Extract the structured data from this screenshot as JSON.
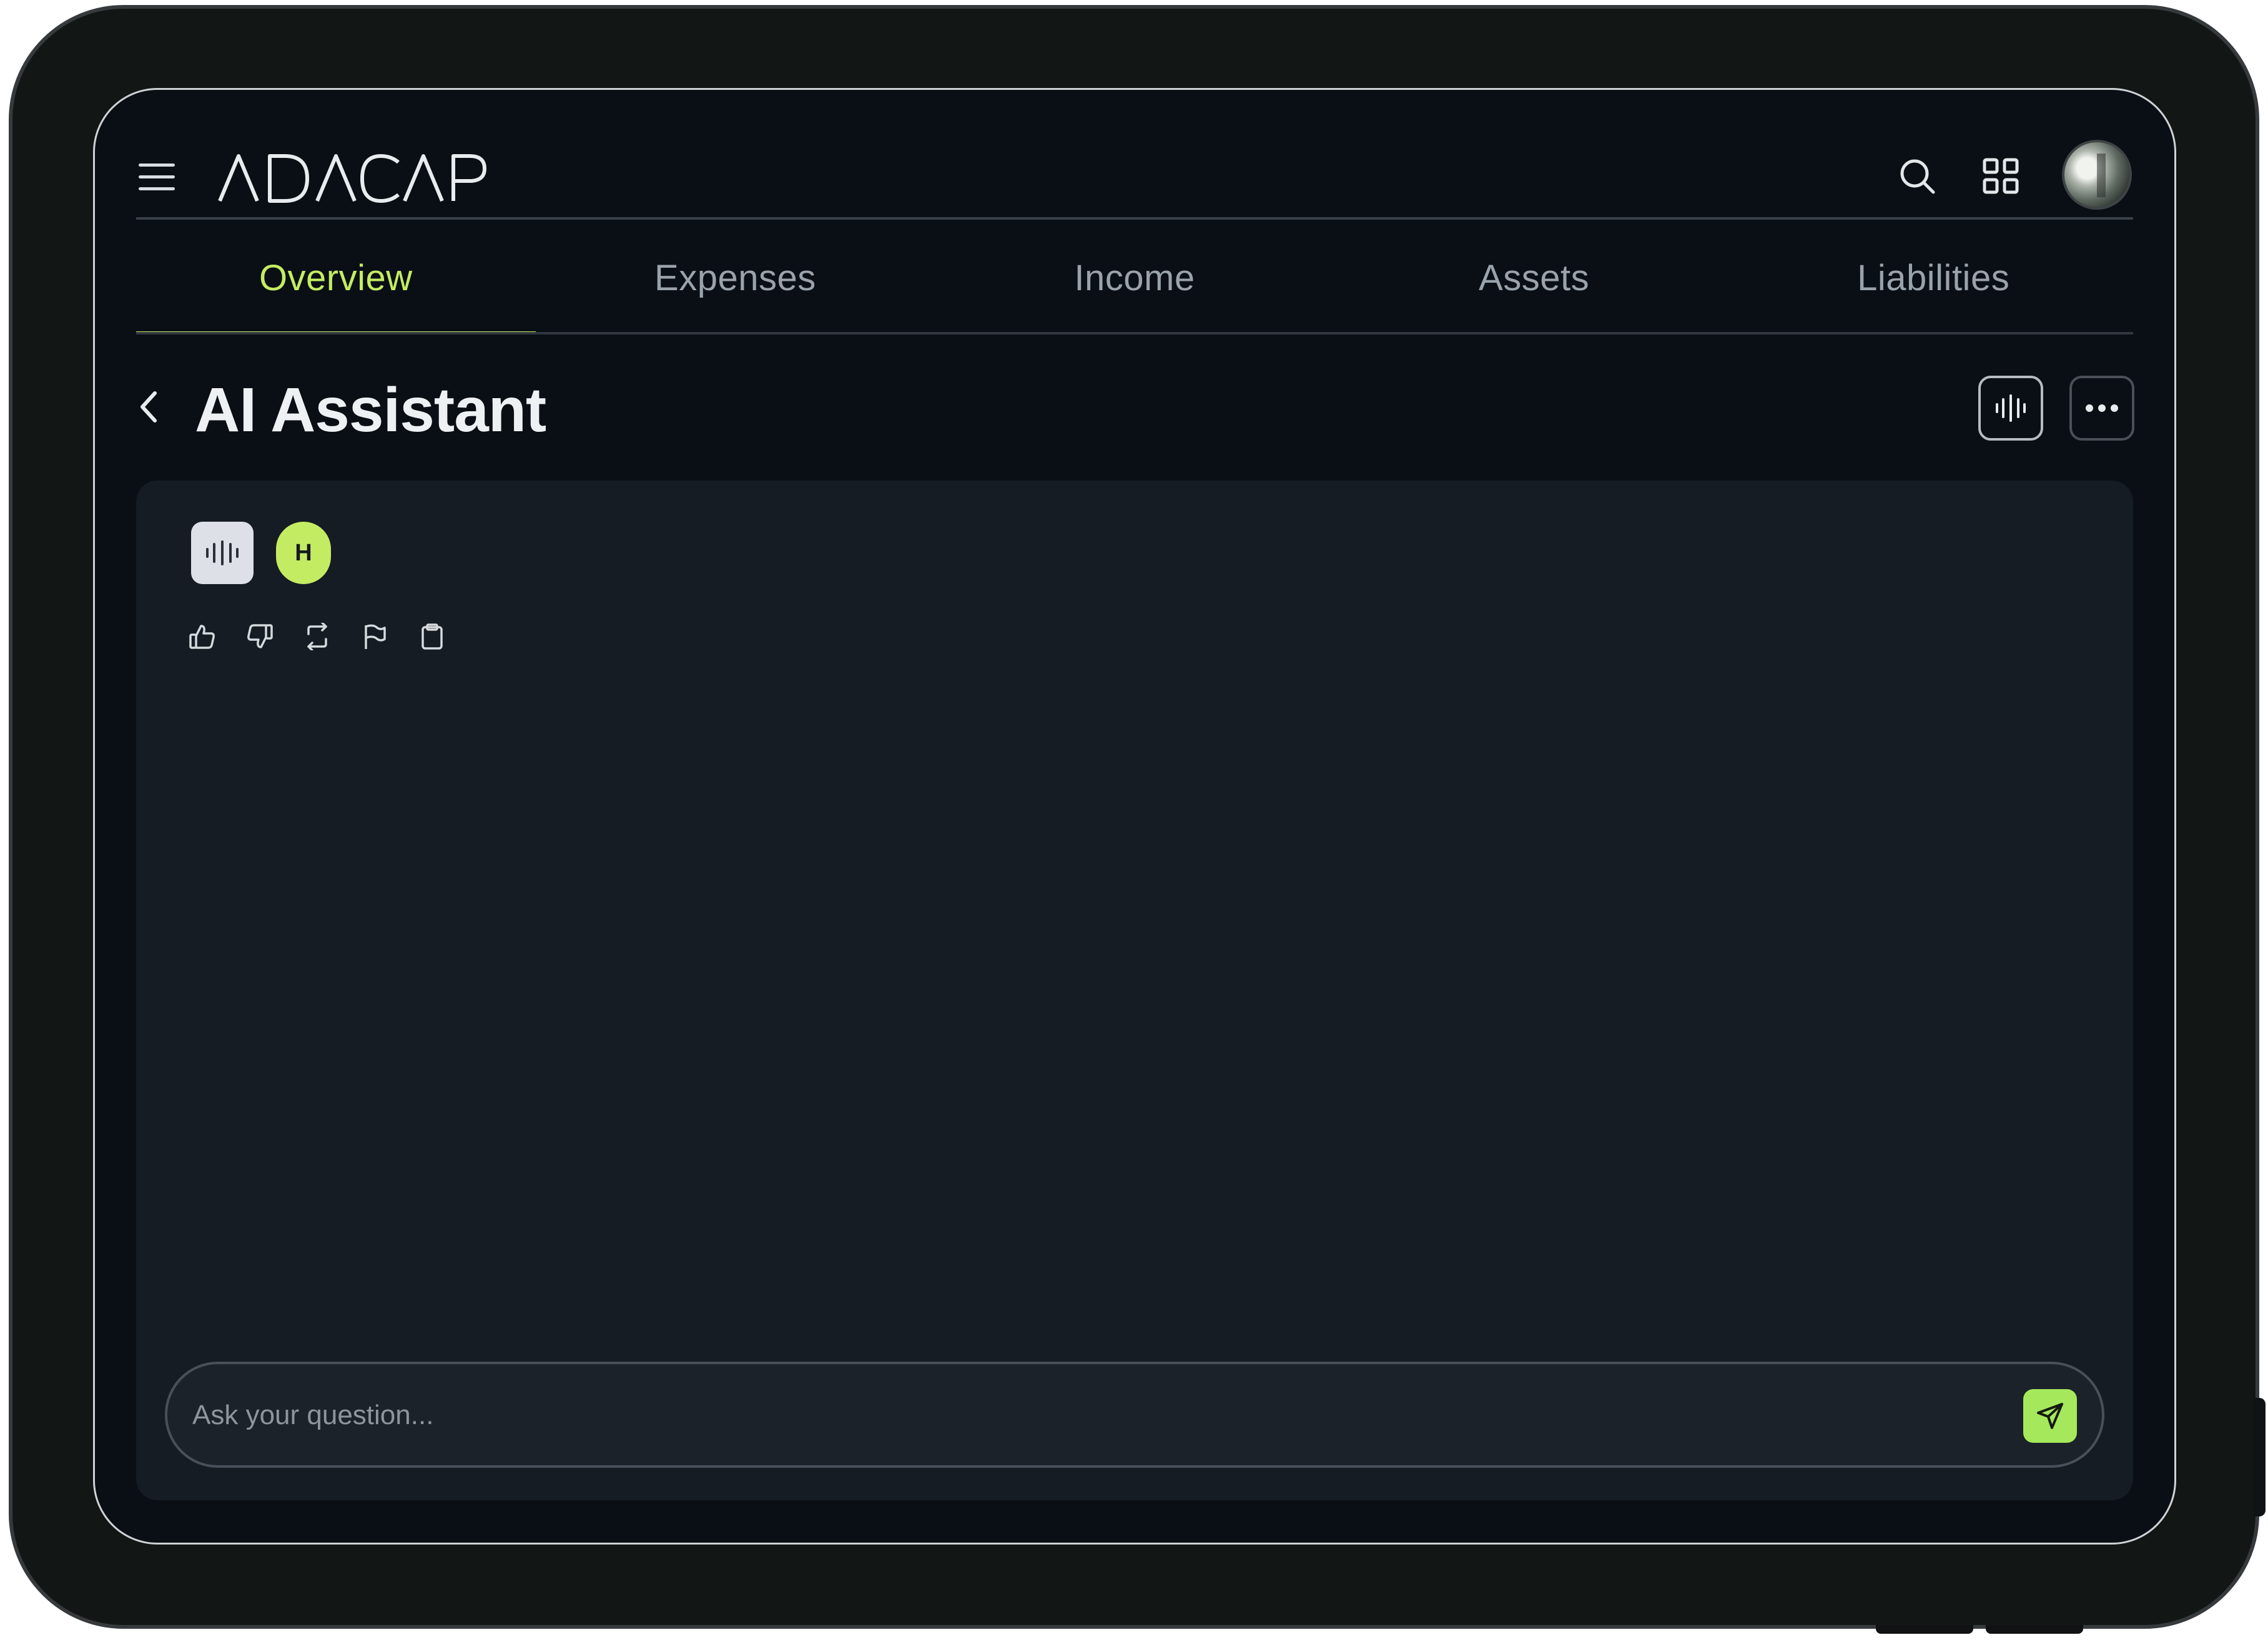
{
  "header": {
    "logo_text": "ADACAP",
    "menu_icon": "hamburger-icon",
    "search_icon": "search-icon",
    "apps_icon": "grid-icon",
    "avatar_icon": "user-avatar"
  },
  "tabs": [
    {
      "label": "Overview",
      "active": true
    },
    {
      "label": "Expenses",
      "active": false
    },
    {
      "label": "Income",
      "active": false
    },
    {
      "label": "Assets",
      "active": false
    },
    {
      "label": "Liabilities",
      "active": false
    }
  ],
  "page": {
    "title": "AI Assistant",
    "back_icon": "chevron-left-icon",
    "voice_icon": "waveform-icon",
    "more_icon": "ellipsis-icon"
  },
  "chat": {
    "user_initial": "H",
    "actions": [
      "thumbs-up-icon",
      "thumbs-down-icon",
      "refresh-icon",
      "flag-icon",
      "clipboard-icon"
    ],
    "input_placeholder": "Ask your question...",
    "send_icon": "send-icon"
  },
  "colors": {
    "accent": "#c4ec63",
    "send_button": "#a6e85b",
    "screen_bg": "#0a0f15",
    "panel_bg": "#161c23"
  }
}
